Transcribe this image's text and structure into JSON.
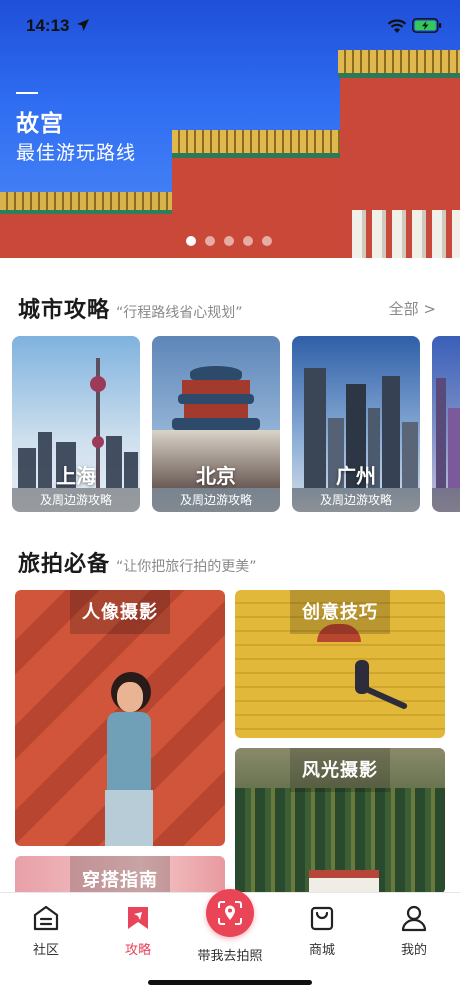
{
  "status_bar": {
    "time": "14:13"
  },
  "banner": {
    "title": "故宫",
    "subtitle": "最佳游玩路线",
    "slide_count": 5,
    "active_slide": 1
  },
  "city_section": {
    "title": "城市攻略",
    "quote": "“行程路线省心规划”",
    "more": "全部 >"
  },
  "cities": [
    {
      "name": "上海",
      "caption": "及周边游攻略"
    },
    {
      "name": "北京",
      "caption": "及周边游攻略"
    },
    {
      "name": "广州",
      "caption": "及周边游攻略"
    }
  ],
  "photo_section": {
    "title": "旅拍必备",
    "quote": "“让你把旅行拍的更美”"
  },
  "photo_tiles": [
    {
      "label": "人像摄影"
    },
    {
      "label": "创意技巧"
    },
    {
      "label": "风光摄影"
    },
    {
      "label": "穿搭指南"
    }
  ],
  "tabbar": {
    "items": [
      {
        "label": "社区",
        "icon": "community-icon"
      },
      {
        "label": "攻略",
        "icon": "guide-flag-icon",
        "active": true
      },
      {
        "label": "带我去拍照",
        "icon": "location-camera-icon"
      },
      {
        "label": "商城",
        "icon": "shopping-bag-icon"
      },
      {
        "label": "我的",
        "icon": "profile-icon"
      }
    ]
  },
  "colors": {
    "accent": "#e8445a",
    "text": "#1a1a1a",
    "muted": "#8a8a8a"
  }
}
